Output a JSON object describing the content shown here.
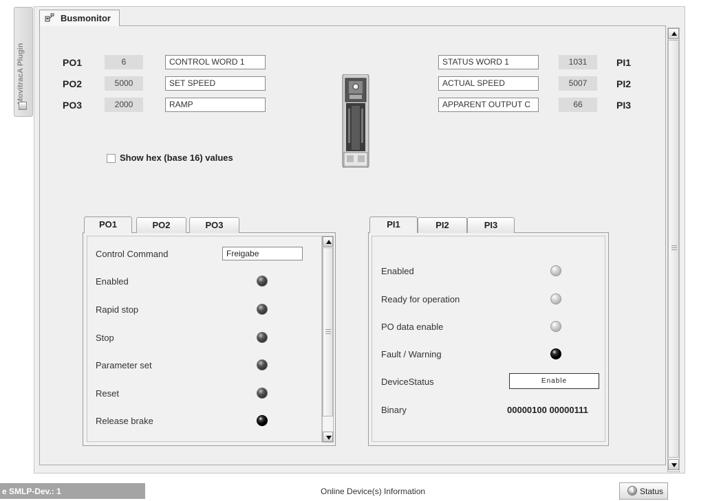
{
  "plugin_strip": {
    "label": "MovitracA Plugin",
    "icon": "plugin-icon"
  },
  "main_tab": {
    "label": "Busmonitor",
    "icon": "network-icon"
  },
  "process_outputs": [
    {
      "label": "PO1",
      "value": "6",
      "description": "CONTROL WORD 1"
    },
    {
      "label": "PO2",
      "value": "5000",
      "description": "SET SPEED"
    },
    {
      "label": "PO3",
      "value": "2000",
      "description": "RAMP"
    }
  ],
  "process_inputs": [
    {
      "label": "PI1",
      "value": "1031",
      "description": "STATUS WORD 1"
    },
    {
      "label": "PI2",
      "value": "5007",
      "description": "ACTUAL SPEED"
    },
    {
      "label": "PI3",
      "value": "66",
      "description": "APPARENT OUTPUT C"
    }
  ],
  "hex_option": {
    "label": "Show hex (base 16) values",
    "checked": false
  },
  "po_panel": {
    "tabs": [
      "PO1",
      "PO2",
      "PO3"
    ],
    "active_tab": "PO1",
    "control_command_label": "Control Command",
    "control_command_value": "Freigabe",
    "rows": [
      {
        "label": "Enabled",
        "state": "dark"
      },
      {
        "label": "Rapid stop",
        "state": "dark"
      },
      {
        "label": "Stop",
        "state": "dark"
      },
      {
        "label": "Parameter set",
        "state": "dark"
      },
      {
        "label": "Reset",
        "state": "dark"
      },
      {
        "label": "Release brake",
        "state": "black"
      }
    ]
  },
  "pi_panel": {
    "tabs": [
      "PI1",
      "PI2",
      "PI3"
    ],
    "active_tab": "PI1",
    "rows": [
      {
        "label": "Enabled",
        "state": "light"
      },
      {
        "label": "Ready for operation",
        "state": "light"
      },
      {
        "label": "PO data enable",
        "state": "light"
      },
      {
        "label": "Fault / Warning",
        "state": "black"
      }
    ],
    "device_status_label": "DeviceStatus",
    "device_status_value": "Enable",
    "binary_label": "Binary",
    "binary_value": "00000100 00000111"
  },
  "status_bar": {
    "left_text": "e SMLP-Dev.: 1",
    "center_text": "Online Device(s) Information",
    "status_button_label": "Status",
    "status_icon": "info-icon"
  }
}
